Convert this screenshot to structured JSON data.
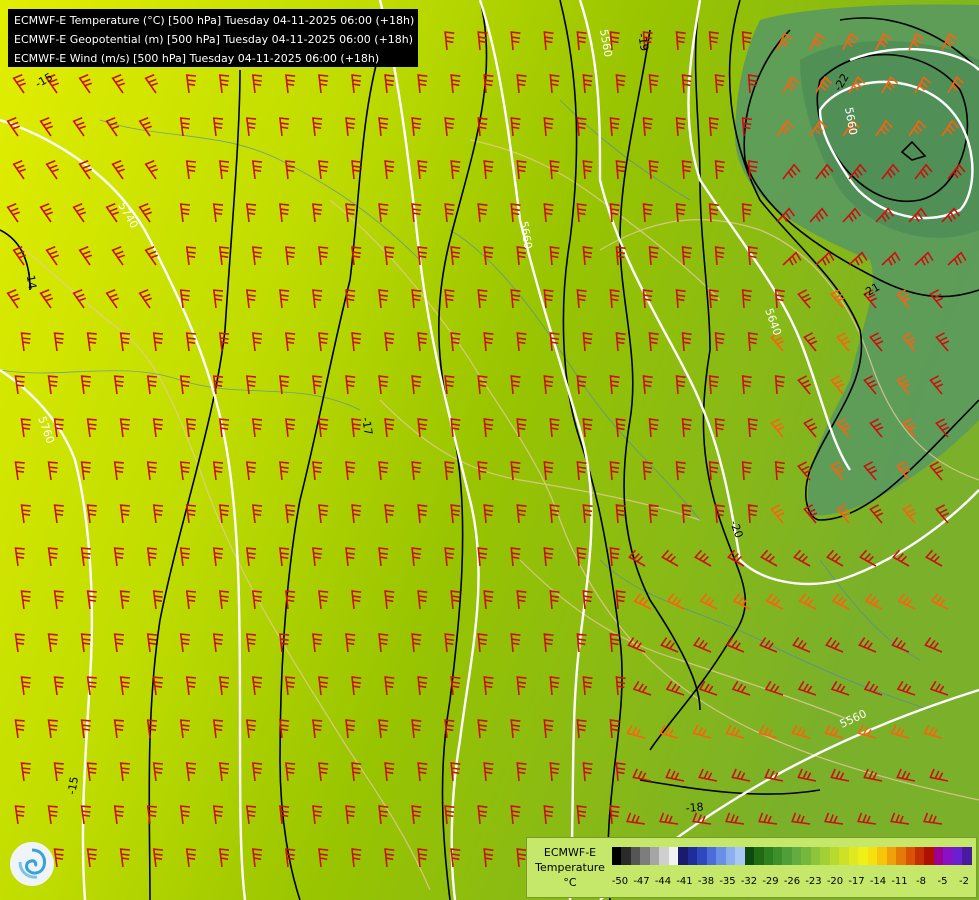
{
  "header": {
    "lines": [
      "ECMWF-E Temperature (°C) [500 hPa] Tuesday 04-11-2025 06:00 (+18h)",
      "ECMWF-E Geopotential (m) [500 hPa] Tuesday 04-11-2025 06:00 (+18h)",
      "ECMWF-E Wind (m/s) [500 hPa] Tuesday 04-11-2025 06:00 (+18h)"
    ]
  },
  "legend": {
    "title_lines": [
      "ECMWF-E",
      "Temperature",
      "°C"
    ],
    "tick_labels": [
      "-50",
      "-47",
      "-44",
      "-41",
      "-38",
      "-35",
      "-32",
      "-29",
      "-26",
      "-23",
      "-20",
      "-17",
      "-14",
      "-11",
      "-8",
      "-5",
      "-2"
    ],
    "colors": [
      "#000000",
      "#2a2a2a",
      "#555555",
      "#7d7d7d",
      "#a5a5a5",
      "#cfcfcf",
      "#f2f2f2",
      "#1a1a6e",
      "#1f2d9b",
      "#2f48c0",
      "#4a6bd8",
      "#6a8fe6",
      "#8bb0ef",
      "#a9c8f5",
      "#0d4a0d",
      "#1f6b14",
      "#2d7f1f",
      "#3e8f2c",
      "#4f9e39",
      "#62ac42",
      "#76b83e",
      "#8cc43a",
      "#a2cf34",
      "#b8d92e",
      "#cde227",
      "#e0e920",
      "#f0ef18",
      "#f7e010",
      "#f7c40c",
      "#f0a008",
      "#e67a06",
      "#d95205",
      "#c43004",
      "#b01004",
      "#a00090",
      "#8a10c8",
      "#6a20d0",
      "#4a1aa0"
    ],
    "colors_count_note": ""
  },
  "map_labels": {
    "geopotential": [
      "5560",
      "5660",
      "5740",
      "5760",
      "5660",
      "5640",
      "5560"
    ],
    "temperature": [
      "-15",
      "-19",
      "-14",
      "-17",
      "-15",
      "-20",
      "-21",
      "-22",
      "-18"
    ]
  },
  "colors": {
    "warm": "#dfee00",
    "cool": "#5c9e58",
    "barb": "#cc1010",
    "barb_strong": "#ff6010"
  }
}
